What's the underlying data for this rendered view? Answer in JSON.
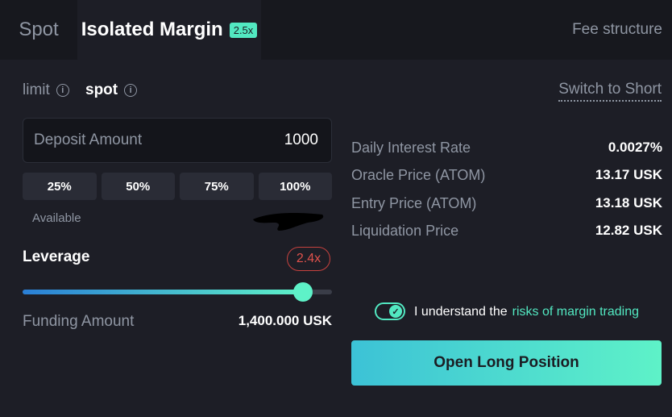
{
  "tabs": {
    "spot": "Spot",
    "isolated": "Isolated Margin",
    "isolated_badge": "2.5x",
    "fee_structure": "Fee structure"
  },
  "order_types": {
    "limit": "limit",
    "spot": "spot",
    "switch": "Switch to Short"
  },
  "deposit": {
    "label": "Deposit Amount",
    "value": "1000"
  },
  "percent_buttons": [
    "25%",
    "50%",
    "75%",
    "100%"
  ],
  "available_label": "Available",
  "leverage": {
    "label": "Leverage",
    "value": "2.4x",
    "slider_fraction": 0.906
  },
  "funding": {
    "label": "Funding Amount",
    "value": "1,400.000 USK"
  },
  "stats": [
    {
      "label": "Daily Interest Rate",
      "value": "0.0027%"
    },
    {
      "label": "Oracle Price (ATOM)",
      "value": "13.17 USK"
    },
    {
      "label": "Entry Price (ATOM)",
      "value": "13.18 USK"
    },
    {
      "label": "Liquidation Price",
      "value": "12.82 USK"
    }
  ],
  "agreement": {
    "text": "I understand the",
    "link": "risks of margin trading",
    "checked": true
  },
  "cta": "Open Long Position",
  "colors": {
    "accent": "#52e8c1",
    "danger": "#e0524c",
    "background": "#1d1e26"
  }
}
